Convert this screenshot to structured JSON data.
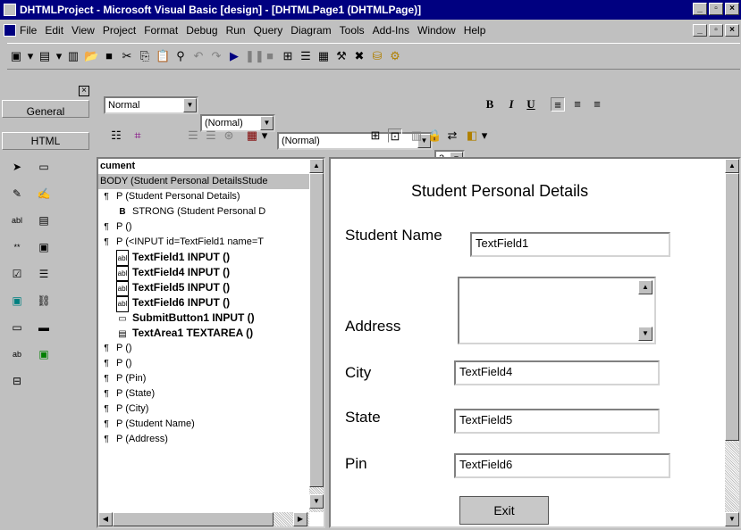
{
  "window": {
    "title": "DHTMLProject - Microsoft Visual Basic [design] - [DHTMLPage1 (DHTMLPage)]",
    "controls": [
      "_",
      "▫",
      "×"
    ],
    "doc_controls": [
      "_",
      "▫",
      "×"
    ]
  },
  "menu": [
    "File",
    "Edit",
    "View",
    "Project",
    "Format",
    "Debug",
    "Run",
    "Query",
    "Diagram",
    "Tools",
    "Add-Ins",
    "Window",
    "Help"
  ],
  "format_bar": {
    "style": "Normal",
    "font_family": "(Normal)",
    "font_size_name": "(Normal)",
    "size_num": "3"
  },
  "toolbox": {
    "tabs": [
      "General",
      "HTML"
    ]
  },
  "tree": {
    "header": "cument",
    "rows": [
      {
        "icon": "",
        "text": "BODY (Student Personal DetailsStude",
        "bold": false,
        "indent": 0,
        "selected": true
      },
      {
        "icon": "P",
        "text": "P (Student Personal Details)",
        "bold": false,
        "indent": 0
      },
      {
        "icon": "B",
        "text": "STRONG (Student Personal D",
        "bold": false,
        "indent": 1
      },
      {
        "icon": "P",
        "text": "P ()",
        "bold": false,
        "indent": 0
      },
      {
        "icon": "P",
        "text": "P (<INPUT id=TextField1 name=T",
        "bold": false,
        "indent": 0
      },
      {
        "icon": "abl",
        "text": "TextField1 INPUT ()",
        "bold": true,
        "indent": 1
      },
      {
        "icon": "abl",
        "text": "TextField4 INPUT ()",
        "bold": true,
        "indent": 1
      },
      {
        "icon": "abl",
        "text": "TextField5 INPUT ()",
        "bold": true,
        "indent": 1
      },
      {
        "icon": "abl",
        "text": "TextField6 INPUT ()",
        "bold": true,
        "indent": 1
      },
      {
        "icon": "btn",
        "text": "SubmitButton1 INPUT ()",
        "bold": true,
        "indent": 1
      },
      {
        "icon": "ta",
        "text": "TextArea1 TEXTAREA ()",
        "bold": true,
        "indent": 1
      },
      {
        "icon": "P",
        "text": "P ()",
        "bold": false,
        "indent": 0
      },
      {
        "icon": "P",
        "text": "P ()",
        "bold": false,
        "indent": 0
      },
      {
        "icon": "P",
        "text": "P (Pin)",
        "bold": false,
        "indent": 0
      },
      {
        "icon": "P",
        "text": "P (State)",
        "bold": false,
        "indent": 0
      },
      {
        "icon": "P",
        "text": "P (City)",
        "bold": false,
        "indent": 0
      },
      {
        "icon": "P",
        "text": "P (Student Name)",
        "bold": false,
        "indent": 0
      },
      {
        "icon": "P",
        "text": "P (Address)",
        "bold": false,
        "indent": 0
      }
    ]
  },
  "form": {
    "heading": "Student Personal Details",
    "name_label": "Student Name",
    "name_value": "TextField1",
    "address_label": "Address",
    "city_label": "City",
    "city_value": "TextField4",
    "state_label": "State",
    "state_value": "TextField5",
    "pin_label": "Pin",
    "pin_value": "TextField6",
    "exit_label": "Exit"
  }
}
